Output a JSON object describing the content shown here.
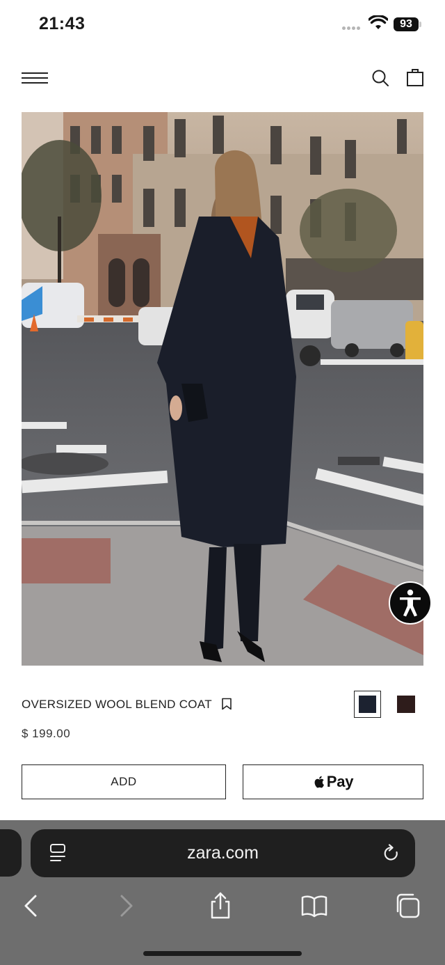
{
  "status_bar": {
    "time": "21:43",
    "battery": "93"
  },
  "product": {
    "name": "OVERSIZED WOOL BLEND COAT",
    "price": "$ 199.00",
    "colors": [
      "#1c2230",
      "#2e1c1b"
    ],
    "selected_color": "#1c2230",
    "add_label": "ADD",
    "applepay_label": "Pay"
  },
  "browser": {
    "url": "zara.com"
  },
  "icons": {
    "header": [
      "menu-icon",
      "search-icon",
      "bag-icon"
    ],
    "toolbar": [
      "back-icon",
      "forward-icon",
      "share-icon",
      "bookmarks-icon",
      "tabs-icon"
    ],
    "other": [
      "bookmark-icon",
      "accessibility-icon",
      "apple-logo-icon",
      "page-menu-icon",
      "reload-icon"
    ]
  }
}
